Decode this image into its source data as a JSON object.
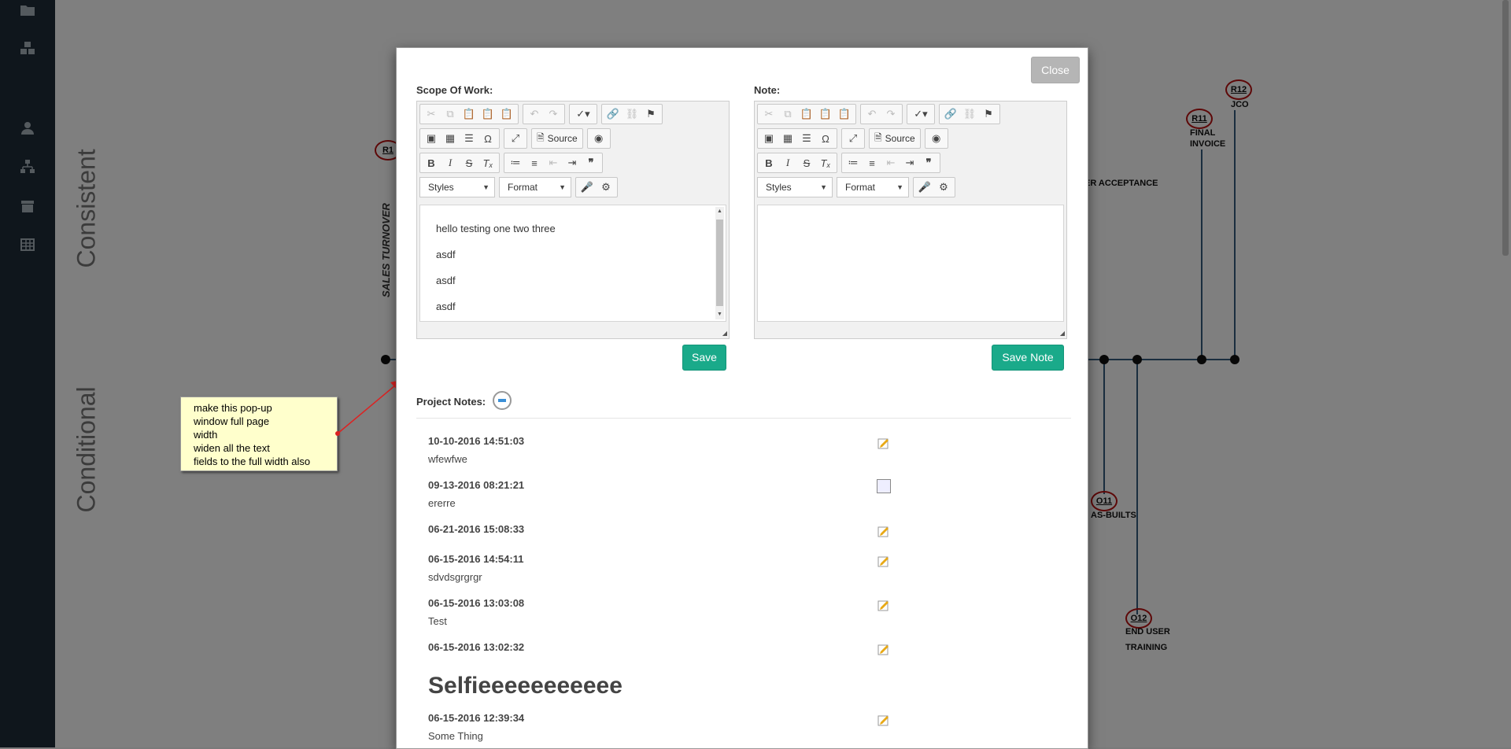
{
  "background": {
    "row_labels": [
      "Consistent",
      "Conditional"
    ],
    "vertical_label": "SALES TURNOVER",
    "milestones": [
      {
        "id": "R1"
      },
      {
        "id": "R11",
        "label": "FINAL\nINVOICE"
      },
      {
        "id": "R12",
        "label": "JCO"
      },
      {
        "id": "O11",
        "label": "AS-BUILTS"
      },
      {
        "id": "O12",
        "label": "END USER\nTRAINING"
      }
    ],
    "partial_label": "ER ACCEPTANCE"
  },
  "annotation": {
    "text": "make this pop-up\nwindow full page\nwidth\nwiden all the text\nfields to the full width also"
  },
  "modal": {
    "close_label": "Close",
    "scope": {
      "label": "Scope Of Work:",
      "source_label": "Source",
      "styles_label": "Styles",
      "format_label": "Format",
      "content": [
        "hello testing one two three",
        "asdf",
        "asdf",
        "asdf"
      ],
      "save_label": "Save"
    },
    "note": {
      "label": "Note:",
      "source_label": "Source",
      "styles_label": "Styles",
      "format_label": "Format",
      "save_label": "Save Note"
    },
    "project_notes": {
      "label": "Project Notes:",
      "entries": [
        {
          "date": "10-10-2016 14:51:03",
          "text": "wfewfwe",
          "icon": "edit-icon"
        },
        {
          "date": "09-13-2016 08:21:21",
          "text": "ererre",
          "icon": "broken-image-icon"
        },
        {
          "date": "06-21-2016 15:08:33",
          "text": "",
          "icon": "edit-icon"
        },
        {
          "date": "06-15-2016 14:54:11",
          "text": "sdvdsgrgrgr",
          "icon": "edit-icon"
        },
        {
          "date": "06-15-2016 13:03:08",
          "text": "Test",
          "icon": "edit-icon"
        },
        {
          "date": "06-15-2016 13:02:32",
          "text": "Selfieeeeeeeeeee",
          "icon": "edit-icon",
          "large": true
        },
        {
          "date": "06-15-2016 12:39:34",
          "text": "Some Thing",
          "icon": "edit-icon"
        }
      ]
    }
  },
  "colors": {
    "sidebar": "#1e2c38",
    "green_button": "#1aaa8a",
    "close_button": "#b5b5b5",
    "timeline": "#345d7f",
    "milestone_ring": "#b11111",
    "callout_bg": "#ffffcc"
  }
}
